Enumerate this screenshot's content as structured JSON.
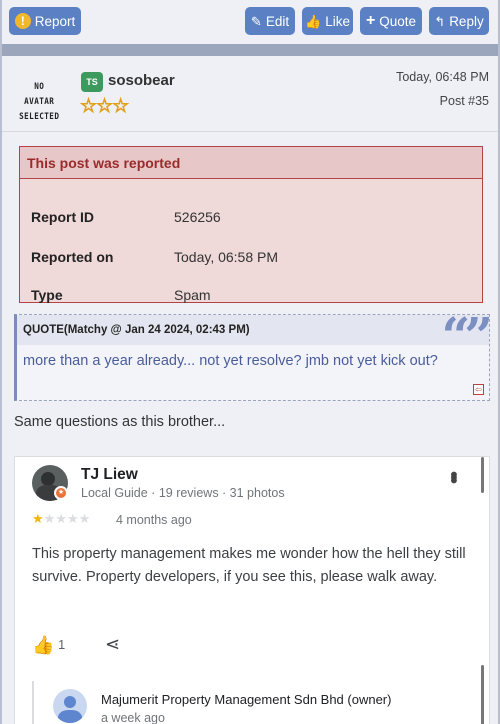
{
  "toolbar": {
    "report": "Report",
    "edit": "Edit",
    "like": "Like",
    "quote": "Quote",
    "reply": "Reply"
  },
  "post": {
    "no_avatar_line1": "NO AVATAR",
    "no_avatar_line2": "SELECTED",
    "initials": "TS",
    "username": "sosobear",
    "rank_stars": 3,
    "time": "Today, 06:48 PM",
    "number": "Post #35"
  },
  "report": {
    "title": "This post was reported",
    "rows": [
      {
        "key": "Report ID",
        "value": "526256"
      },
      {
        "key": "Reported on",
        "value": "Today, 06:58 PM"
      },
      {
        "key": "Type",
        "value": "Spam"
      }
    ]
  },
  "quote": {
    "header": "QUOTE(Matchy @ Jan 24 2024, 02:43 PM)",
    "text": "more than a year already... not yet resolve? jmb not yet kick out?"
  },
  "post_text": "Same questions as this brother...",
  "review": {
    "name": "TJ Liew",
    "meta": "Local Guide · 19 reviews · 31 photos",
    "rating": 1,
    "rating_max": 5,
    "time": "4 months ago",
    "text": "This property management makes me wonder how the hell they still survive. Property developers, if you see this, please walk away.",
    "likes": "1",
    "owner_name": "Majumerit Property Management Sdn Bhd (owner)",
    "owner_time": "a week ago"
  },
  "colors": {
    "button_bg": "#5b81c4",
    "report_border": "#b14545",
    "quote_text": "#4a5d9a"
  }
}
